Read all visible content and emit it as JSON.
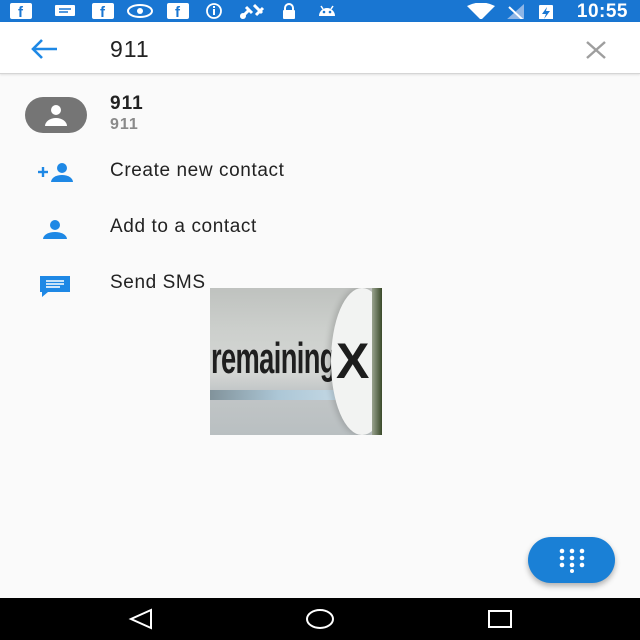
{
  "status_bar": {
    "time": "10:55",
    "left_icons": [
      "facebook-icon",
      "message-icon",
      "facebook-icon",
      "eye-icon",
      "facebook-icon",
      "info-icon",
      "satellite-icon",
      "lock-icon",
      "android-icon"
    ],
    "right_icons": [
      "wifi-icon",
      "signal-icon",
      "battery-charging-icon"
    ],
    "background": "#1976d2"
  },
  "search": {
    "query": "911"
  },
  "result": {
    "name": "911",
    "number": "911"
  },
  "actions": [
    {
      "label": "Create new contact",
      "icon": "add-person-icon"
    },
    {
      "label": "Add to a contact",
      "icon": "person-icon"
    },
    {
      "label": "Send SMS",
      "icon": "message-icon"
    }
  ],
  "popup": {
    "text": "remaining",
    "close_glyph": "X"
  },
  "colors": {
    "accent": "#1a80d6",
    "icon_blue": "#1e88e5",
    "avatar": "#757575"
  },
  "nav_bar": {
    "icons": [
      "back-icon",
      "home-icon",
      "recents-icon"
    ]
  }
}
